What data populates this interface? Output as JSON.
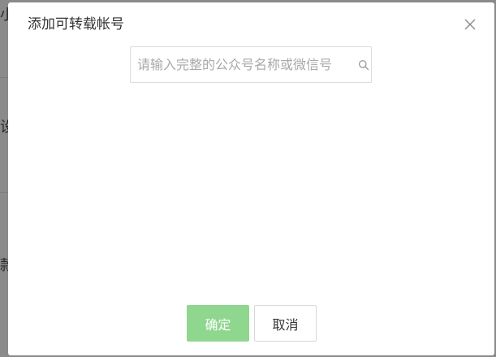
{
  "background": {
    "glyphs": [
      "小",
      "设",
      "款"
    ]
  },
  "dialog": {
    "title": "添加可转载帐号",
    "close_icon": "close-icon",
    "search": {
      "placeholder": "请输入完整的公众号名称或微信号",
      "value": "",
      "icon": "search-icon"
    },
    "confirm_label": "确定",
    "cancel_label": "取消"
  },
  "colors": {
    "confirm_disabled": "#8fd68f",
    "overlay": "#8a8a8a"
  }
}
